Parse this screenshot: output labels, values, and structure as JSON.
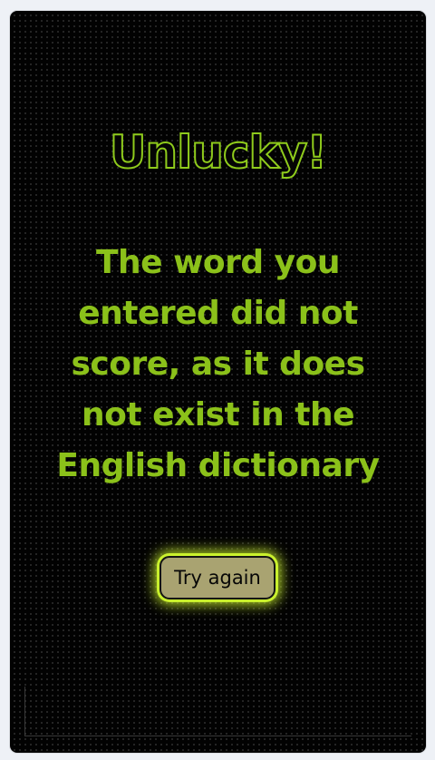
{
  "result": {
    "title": "Unlucky!",
    "message": "The word you entered did not score, as it does not exist in the English dictionary",
    "retry_label": "Try again"
  },
  "colors": {
    "accent": "#8bc11a",
    "glow": "#c9f02d",
    "button_fill": "#a9a371",
    "card_background": "#020202",
    "page_background": "#eef1f6"
  }
}
